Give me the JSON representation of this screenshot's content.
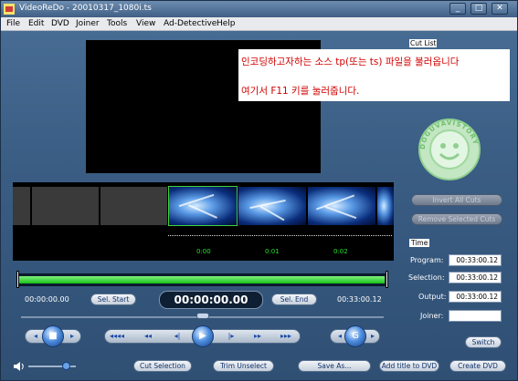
{
  "window": {
    "title": "VideoReDo - 20010317_1080i.ts"
  },
  "menu": [
    "File",
    "Edit",
    "DVD",
    "Joiner",
    "Tools",
    "View",
    "Ad-Detective",
    "Help"
  ],
  "note": {
    "line1": "인코딩하고자하는 소스 tp(또는 ts) 파일을 불러옵니다",
    "line2": "여기서 F11 키를 눌러줍니다."
  },
  "cut_list": {
    "label": "Cut List",
    "invert_all_cuts": "Invert All Cuts",
    "remove_selected_cuts": "Remove Selected Cuts"
  },
  "seal": {
    "text": "DOGUVAVISTORY"
  },
  "timeline": {
    "timecodes": [
      "0:00",
      "0:01",
      "0:02"
    ]
  },
  "progress": {
    "fraction": 0.99
  },
  "transport": {
    "start_time": "00:00:00.00",
    "current_time": "00:00:00.00",
    "end_time": "00:33:00.12",
    "sel_start": "Sel. Start",
    "sel_end": "Sel. End"
  },
  "time_panel": {
    "label": "Time",
    "program_label": "Program:",
    "program_value": "00:33:00.12",
    "selection_label": "Selection:",
    "selection_value": "00:33:00.12",
    "output_label": "Output:",
    "output_value": "00:33:00.12",
    "joiner_label": "Joiner:",
    "joiner_value": "",
    "switch": "Switch"
  },
  "bottom_buttons": {
    "cut_selection": "Cut Selection",
    "trim_unselect": "Trim Unselect",
    "save_as": "Save As...",
    "add_title_to_dvd": "Add title to DVD",
    "create_dvd": "Create DVD"
  },
  "volume": {
    "level": 0.8
  },
  "colors": {
    "progress": "#19c119",
    "note_text": "#d10000",
    "timecode": "#27e02d"
  }
}
